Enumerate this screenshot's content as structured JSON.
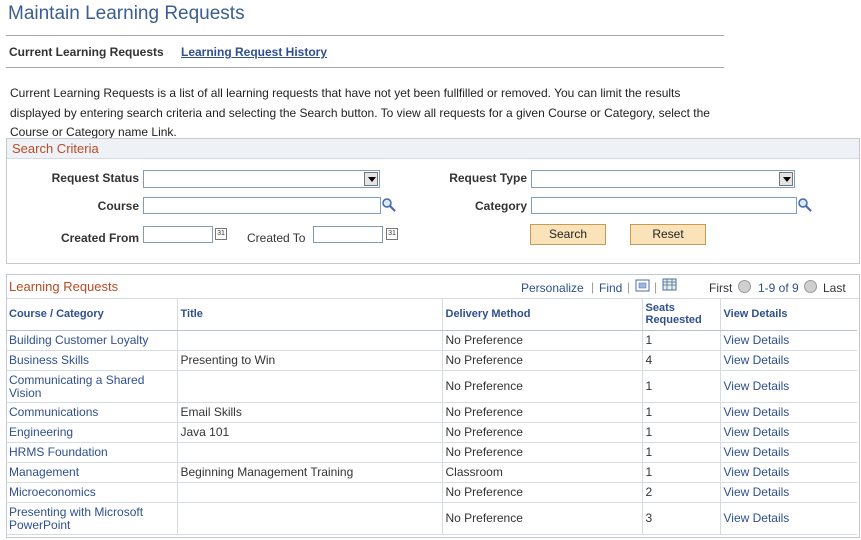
{
  "page": {
    "title": "Maintain Learning Requests",
    "tabs": [
      {
        "label": "Current Learning Requests"
      },
      {
        "label": "Learning Request History"
      }
    ],
    "intro": "Current Learning Requests is a list of all learning requests that have not yet been fullfilled or removed.  You can limit the results displayed by entering search criteria and selecting the Search button.  To view all requests for a given Course or Category, select the Course or Category name Link."
  },
  "search": {
    "header": "Search Criteria",
    "request_status_label": "Request Status",
    "request_status_value": "",
    "request_type_label": "Request Type",
    "request_type_value": "",
    "course_label": "Course",
    "course_value": "",
    "category_label": "Category",
    "category_value": "",
    "created_from_label": "Created From",
    "created_from_value": "",
    "created_to_label": "Created To",
    "created_to_value": "",
    "search_button": "Search",
    "reset_button": "Reset",
    "calendar_glyph": "31"
  },
  "grid": {
    "title": "Learning Requests",
    "personalize": "Personalize",
    "find": "Find",
    "first": "First",
    "range": "1-9 of 9",
    "last": "Last",
    "columns": [
      "Course / Category",
      "Title",
      "Delivery Method",
      "Seats Requested",
      "View Details"
    ],
    "rows": [
      {
        "course": "Building Customer Loyalty",
        "title": "",
        "delivery": "No Preference",
        "seats": "1",
        "details": "View Details"
      },
      {
        "course": "Business Skills",
        "title": "Presenting to Win",
        "delivery": "No Preference",
        "seats": "4",
        "details": "View Details"
      },
      {
        "course": "Communicating a Shared Vision",
        "title": "",
        "delivery": "No Preference",
        "seats": "1",
        "details": "View Details"
      },
      {
        "course": "Communications",
        "title": "Email Skills",
        "delivery": "No Preference",
        "seats": "1",
        "details": "View Details"
      },
      {
        "course": "Engineering",
        "title": "Java 101",
        "delivery": "No Preference",
        "seats": "1",
        "details": "View Details"
      },
      {
        "course": "HRMS Foundation",
        "title": "",
        "delivery": "No Preference",
        "seats": "1",
        "details": "View Details"
      },
      {
        "course": "Management",
        "title": "Beginning Management Training",
        "delivery": "Classroom",
        "seats": "1",
        "details": "View Details"
      },
      {
        "course": "Microeconomics",
        "title": "",
        "delivery": "No Preference",
        "seats": "2",
        "details": "View Details"
      },
      {
        "course": "Presenting with Microsoft PowerPoint",
        "title": "",
        "delivery": "No Preference",
        "seats": "3",
        "details": "View Details"
      }
    ]
  },
  "colors": {
    "title_blue": "#3a5e92",
    "link_blue": "#2f4f8f",
    "header_orange": "#b94a24",
    "button_fill": "#fbe3b9"
  }
}
